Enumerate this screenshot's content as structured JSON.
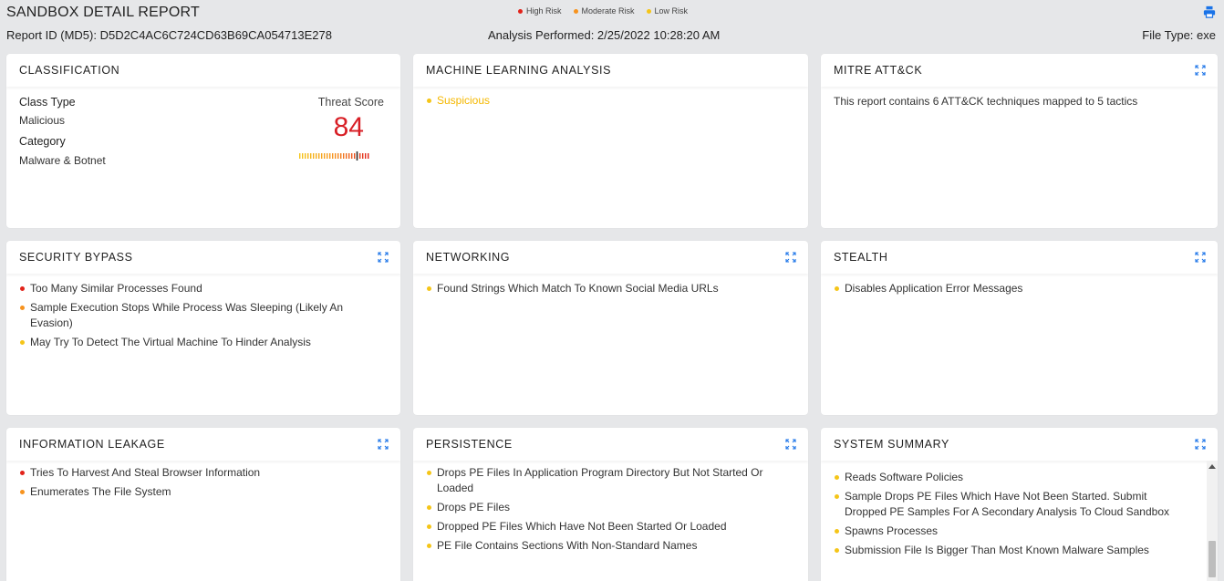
{
  "header": {
    "title": "SANDBOX DETAIL REPORT",
    "report_id": "Report ID (MD5): D5D2C4AC6C724CD63B69CA054713E278",
    "analysis": "Analysis Performed: 2/25/2022 10:28:20 AM",
    "file_type": "File Type: exe",
    "print_icon": "print-icon",
    "legend": [
      {
        "label": "High Risk",
        "color": "#e2231a"
      },
      {
        "label": "Moderate Risk",
        "color": "#f7931e"
      },
      {
        "label": "Low Risk",
        "color": "#f5c518"
      }
    ]
  },
  "classification": {
    "title": "CLASSIFICATION",
    "class_type_label": "Class Type",
    "class_type_value": "Malicious",
    "category_label": "Category",
    "category_value": "Malware & Botnet",
    "threat_score_label": "Threat Score",
    "threat_score": "84",
    "threat_score_level": 0.84
  },
  "ml": {
    "title": "MACHINE LEARNING ANALYSIS",
    "items": [
      {
        "text": "Suspicious",
        "color": "#f5c518"
      }
    ]
  },
  "mitre": {
    "title": "MITRE ATT&CK",
    "text": "This report contains 6 ATT&CK techniques mapped to 5 tactics"
  },
  "security_bypass": {
    "title": "SECURITY BYPASS",
    "items": [
      {
        "text": "Too Many Similar Processes Found",
        "color": "#e2231a"
      },
      {
        "text": "Sample Execution Stops While Process Was Sleeping (Likely An Evasion)",
        "color": "#f7931e"
      },
      {
        "text": "May Try To Detect The Virtual Machine To Hinder Analysis",
        "color": "#f5c518"
      }
    ]
  },
  "networking": {
    "title": "NETWORKING",
    "items": [
      {
        "text": "Found Strings Which Match To Known Social Media URLs",
        "color": "#f5c518"
      }
    ]
  },
  "stealth": {
    "title": "STEALTH",
    "items": [
      {
        "text": "Disables Application Error Messages",
        "color": "#f5c518"
      }
    ]
  },
  "info_leakage": {
    "title": "INFORMATION LEAKAGE",
    "items": [
      {
        "text": "Tries To Harvest And Steal Browser Information",
        "color": "#e2231a"
      },
      {
        "text": "Enumerates The File System",
        "color": "#f7931e"
      }
    ]
  },
  "persistence": {
    "title": "PERSISTENCE",
    "items": [
      {
        "text": "Drops PE Files In Application Program Directory But Not Started Or Loaded",
        "color": "#f5c518"
      },
      {
        "text": "Drops PE Files",
        "color": "#f5c518"
      },
      {
        "text": "Dropped PE Files Which Have Not Been Started Or Loaded",
        "color": "#f5c518"
      },
      {
        "text": "PE File Contains Sections With Non-Standard Names",
        "color": "#f5c518"
      }
    ]
  },
  "system_summary": {
    "title": "SYSTEM SUMMARY",
    "items": [
      {
        "text": "Reads Software Policies",
        "color": "#f5c518"
      },
      {
        "text": "Sample Drops PE Files Which Have Not Been Started. Submit Dropped PE Samples For A Secondary Analysis To Cloud Sandbox",
        "color": "#f5c518"
      },
      {
        "text": "Spawns Processes",
        "color": "#f5c518"
      },
      {
        "text": "Submission File Is Bigger Than Most Known Malware Samples",
        "color": "#f5c518"
      }
    ]
  },
  "icons": {
    "expand": "expand-icon",
    "print": "print-icon"
  },
  "colors": {
    "accent": "#1a73e8",
    "score": "#d81f26"
  }
}
